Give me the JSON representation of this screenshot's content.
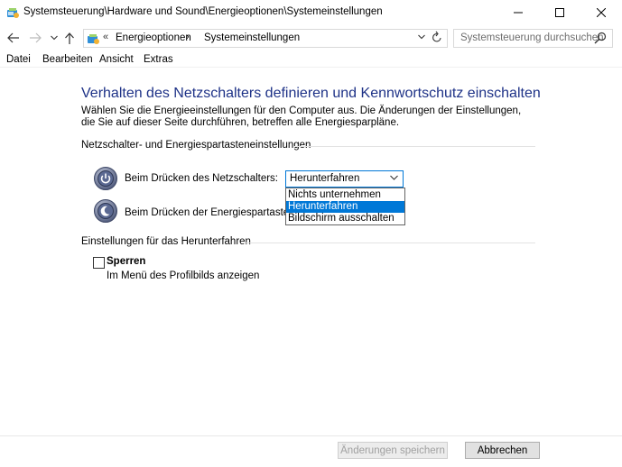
{
  "window": {
    "title": "Systemsteuerung\\Hardware und Sound\\Energieoptionen\\Systemeinstellungen"
  },
  "address": {
    "breadcrumbs": [
      "Energieoptionen",
      "Systemeinstellungen"
    ],
    "overflow": "«",
    "separator": "›"
  },
  "search": {
    "placeholder": "Systemsteuerung durchsuchen"
  },
  "menu": [
    "Datei",
    "Bearbeiten",
    "Ansicht",
    "Extras"
  ],
  "main": {
    "heading": "Verhalten des Netzschalters definieren und Kennwortschutz einschalten",
    "description": "Wählen Sie die Energieeinstellungen für den Computer aus. Die Änderungen der Einstellungen, die Sie auf dieser Seite durchführen, betreffen alle Energiesparpläne.",
    "section_power": "Netzschalter- und Energiespartasteneinstellungen",
    "power_button_label": "Beim Drücken des Netzschalters:",
    "sleep_button_label": "Beim Drücken der Energiespartaste:",
    "power_button_value": "Herunterfahren",
    "dropdown_options": [
      "Nichts unternehmen",
      "Herunterfahren",
      "Bildschirm ausschalten"
    ],
    "dropdown_selected_index": 1,
    "section_shutdown": "Einstellungen für das Herunterfahren",
    "lock_label": "Sperren",
    "lock_checked": false,
    "lock_sub": "Im Menü des Profilbilds anzeigen"
  },
  "footer": {
    "save_label": "Änderungen speichern",
    "cancel_label": "Abbrechen"
  },
  "colors": {
    "heading": "#1e3287",
    "accent": "#0078d7"
  }
}
